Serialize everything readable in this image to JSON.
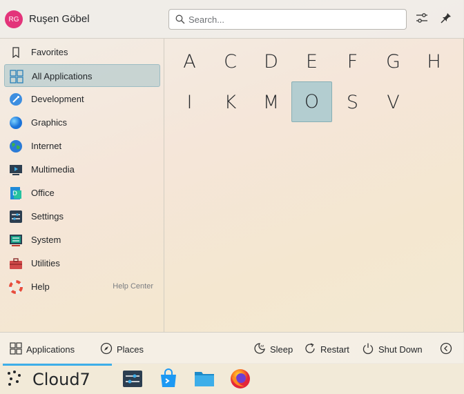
{
  "user": {
    "initials": "RG",
    "name": "Ruşen Göbel"
  },
  "search": {
    "placeholder": "Search..."
  },
  "header_icons": [
    "configure-icon",
    "pin-icon"
  ],
  "categories": [
    {
      "label": "Favorites",
      "icon": "bookmark-icon"
    },
    {
      "label": "All Applications",
      "icon": "grid-icon",
      "active": true
    },
    {
      "label": "Development",
      "icon": "development-icon"
    },
    {
      "label": "Graphics",
      "icon": "graphics-icon"
    },
    {
      "label": "Internet",
      "icon": "globe-icon"
    },
    {
      "label": "Multimedia",
      "icon": "multimedia-icon"
    },
    {
      "label": "Office",
      "icon": "office-icon"
    },
    {
      "label": "Settings",
      "icon": "settings-icon"
    },
    {
      "label": "System",
      "icon": "system-icon"
    },
    {
      "label": "Utilities",
      "icon": "toolbox-icon"
    },
    {
      "label": "Help",
      "icon": "lifebuoy-icon",
      "extra": "Help Center"
    }
  ],
  "letters": [
    "A",
    "C",
    "D",
    "E",
    "F",
    "G",
    "H",
    "I",
    "K",
    "M",
    "O",
    "S",
    "V"
  ],
  "selected_letter": "O",
  "footer": {
    "applications": "Applications",
    "places": "Places",
    "sleep": "Sleep",
    "restart": "Restart",
    "shutdown": "Shut Down"
  },
  "taskbar": {
    "brand": "Cloud7",
    "apps": [
      "settings-app-icon",
      "discover-store-icon",
      "file-manager-icon",
      "firefox-icon"
    ]
  },
  "colors": {
    "accent": "#3daee9",
    "selection": "#b3cdd0",
    "avatar": "#e3347a"
  }
}
